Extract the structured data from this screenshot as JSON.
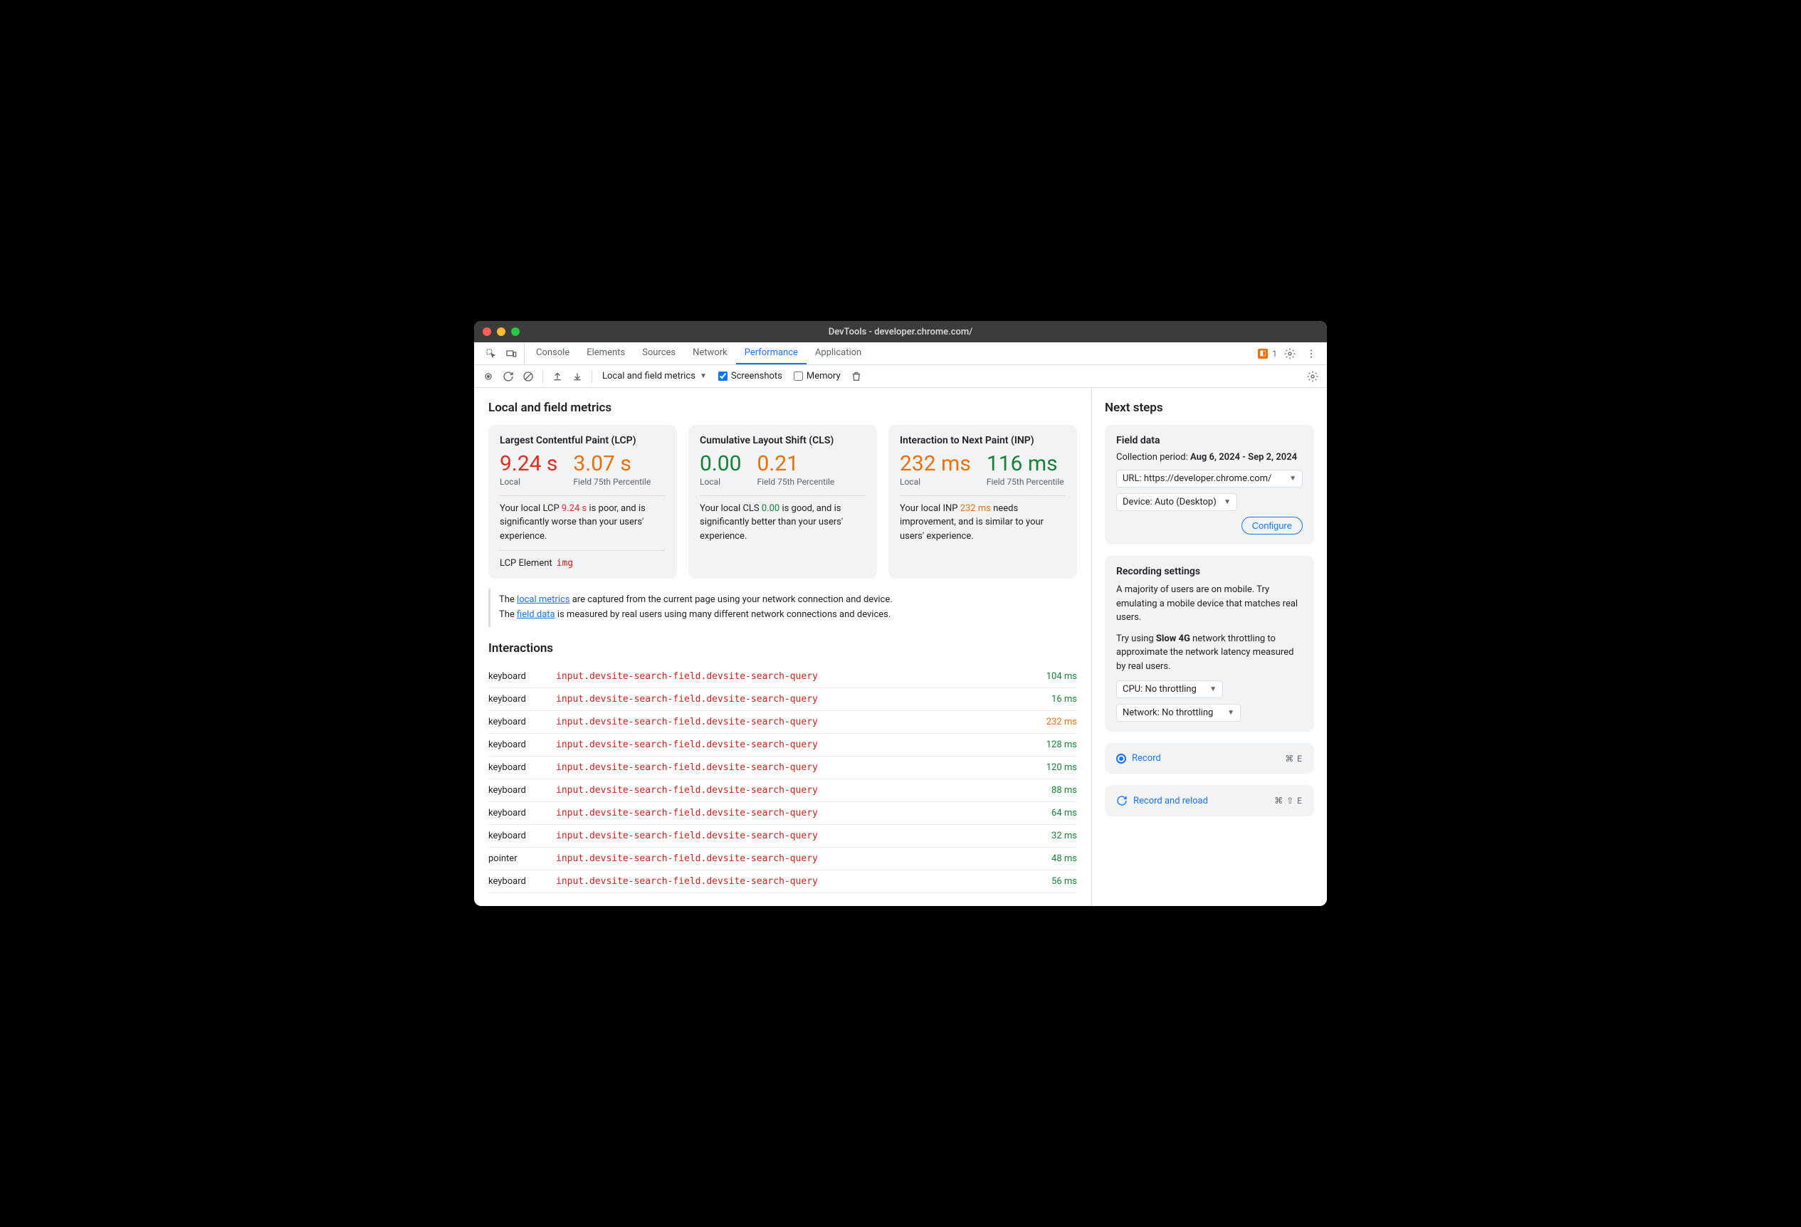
{
  "window": {
    "title": "DevTools - developer.chrome.com/"
  },
  "tabs": {
    "items": [
      "Console",
      "Elements",
      "Sources",
      "Network",
      "Performance",
      "Application"
    ],
    "active": "Performance",
    "issues": "1"
  },
  "toolbar": {
    "view_select": "Local and field metrics",
    "screenshots_label": "Screenshots",
    "screenshots_checked": true,
    "memory_label": "Memory",
    "memory_checked": false
  },
  "main": {
    "heading": "Local and field metrics",
    "metrics": [
      {
        "title": "Largest Contentful Paint (LCP)",
        "local_value": "9.24 s",
        "local_class": "mv-red",
        "field_value": "3.07 s",
        "field_class": "mv-orange",
        "local_label": "Local",
        "field_label": "Field 75th Percentile",
        "desc_prefix": "Your local LCP ",
        "desc_val": "9.24 s",
        "desc_val_class": "r",
        "desc_suffix": " is poor, and is significantly worse than your users' experience.",
        "extra_label": "LCP Element",
        "extra_tag": "img"
      },
      {
        "title": "Cumulative Layout Shift (CLS)",
        "local_value": "0.00",
        "local_class": "mv-green",
        "field_value": "0.21",
        "field_class": "mv-orange",
        "local_label": "Local",
        "field_label": "Field 75th Percentile",
        "desc_prefix": "Your local CLS ",
        "desc_val": "0.00",
        "desc_val_class": "g",
        "desc_suffix": " is good, and is significantly better than your users' experience."
      },
      {
        "title": "Interaction to Next Paint (INP)",
        "local_value": "232 ms",
        "local_class": "mv-orange",
        "field_value": "116 ms",
        "field_class": "mv-green",
        "local_label": "Local",
        "field_label": "Field 75th Percentile",
        "desc_prefix": "Your local INP ",
        "desc_val": "232 ms",
        "desc_val_class": "o",
        "desc_suffix": " needs improvement, and is similar to your users' experience."
      }
    ],
    "info": {
      "line1_a": "The ",
      "line1_link": "local metrics",
      "line1_b": " are captured from the current page using your network connection and device.",
      "line2_a": "The ",
      "line2_link": "field data",
      "line2_b": " is measured by real users using many different network connections and devices."
    },
    "interactions_heading": "Interactions",
    "interactions": [
      {
        "type": "keyboard",
        "target": "input.devsite-search-field.devsite-search-query",
        "time": "104 ms",
        "class": ""
      },
      {
        "type": "keyboard",
        "target": "input.devsite-search-field.devsite-search-query",
        "time": "16 ms",
        "class": ""
      },
      {
        "type": "keyboard",
        "target": "input.devsite-search-field.devsite-search-query",
        "time": "232 ms",
        "class": "orange"
      },
      {
        "type": "keyboard",
        "target": "input.devsite-search-field.devsite-search-query",
        "time": "128 ms",
        "class": ""
      },
      {
        "type": "keyboard",
        "target": "input.devsite-search-field.devsite-search-query",
        "time": "120 ms",
        "class": ""
      },
      {
        "type": "keyboard",
        "target": "input.devsite-search-field.devsite-search-query",
        "time": "88 ms",
        "class": ""
      },
      {
        "type": "keyboard",
        "target": "input.devsite-search-field.devsite-search-query",
        "time": "64 ms",
        "class": ""
      },
      {
        "type": "keyboard",
        "target": "input.devsite-search-field.devsite-search-query",
        "time": "32 ms",
        "class": ""
      },
      {
        "type": "pointer",
        "target": "input.devsite-search-field.devsite-search-query",
        "time": "48 ms",
        "class": ""
      },
      {
        "type": "keyboard",
        "target": "input.devsite-search-field.devsite-search-query",
        "time": "56 ms",
        "class": ""
      }
    ]
  },
  "side": {
    "heading": "Next steps",
    "field_data": {
      "title": "Field data",
      "period_label": "Collection period: ",
      "period_value": "Aug 6, 2024 - Sep 2, 2024",
      "url_select": "URL: https://developer.chrome.com/",
      "device_select": "Device: Auto (Desktop)",
      "configure": "Configure"
    },
    "recording": {
      "title": "Recording settings",
      "p1": "A majority of users are on mobile. Try emulating a mobile device that matches real users.",
      "p2a": "Try using ",
      "p2b": "Slow 4G",
      "p2c": " network throttling to approximate the network latency measured by real users.",
      "cpu_select": "CPU: No throttling",
      "net_select": "Network: No throttling"
    },
    "record": {
      "label": "Record",
      "shortcut": "⌘ E"
    },
    "record_reload": {
      "label": "Record and reload",
      "shortcut": "⌘ ⇧ E"
    }
  }
}
